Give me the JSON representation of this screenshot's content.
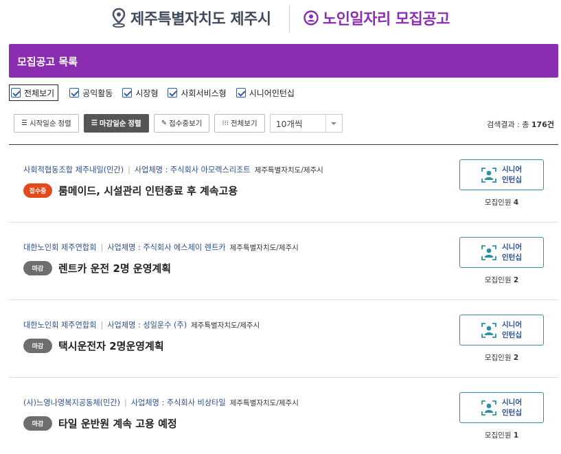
{
  "header": {
    "location": "제주특별자치도 제주시",
    "site_title": "노인일자리 모집공고"
  },
  "section_title": "모집공고 목록",
  "filters": [
    "전체보기",
    "공익활동",
    "시장형",
    "사회서비스형",
    "시니어인턴십"
  ],
  "toolbar": {
    "sort_start": "시작일순 정렬",
    "sort_deadline": "마감일순 정렬",
    "show_open": "접수중보기",
    "show_all": "전체보기",
    "page_size": "10개씩"
  },
  "result": {
    "prefix": "검색결과 : 총",
    "count": "176건"
  },
  "colors": {
    "brand": "#8a2db0",
    "open_badge": "#e04a1c",
    "closed_badge": "#6e6e6e",
    "button_border": "#2f8fa3"
  },
  "listings": [
    {
      "org": "사회적협동조합 제주내일(민간)",
      "company": "사업체명 : 주식회사 아모렉스리조트",
      "region": "제주특별자치도/제주시",
      "status": "접수중",
      "title": "룸메이드, 시설관리 인턴종료 후 계속고용",
      "category": [
        "시니어",
        "인턴십"
      ],
      "recruit_label": "모집인원",
      "recruit_count": "4"
    },
    {
      "org": "대한노인회 제주연합회",
      "company": "사업체명 : 주식회사 에스제이 렌트카",
      "region": "제주특별자치도/제주시",
      "status": "마감",
      "title": "렌트카 운전 2명 운영계획",
      "category": [
        "시니어",
        "인턴십"
      ],
      "recruit_label": "모집인원",
      "recruit_count": "2"
    },
    {
      "org": "대한노인회 제주연합회",
      "company": "사업체명 : 성일운수 (주)",
      "region": "제주특별자치도/제주시",
      "status": "마감",
      "title": "택시운전자 2명운영계획",
      "category": [
        "시니어",
        "인턴십"
      ],
      "recruit_label": "모집인원",
      "recruit_count": "2"
    },
    {
      "org": "(사)느영나영복지공동체(민간)",
      "company": "사업체명 : 주식회사 비상타일",
      "region": "제주특별자치도/제주시",
      "status": "마감",
      "title": "타일 운반원 계속 고용 예정",
      "category": [
        "시니어",
        "인턴십"
      ],
      "recruit_label": "모집인원",
      "recruit_count": "1"
    }
  ]
}
